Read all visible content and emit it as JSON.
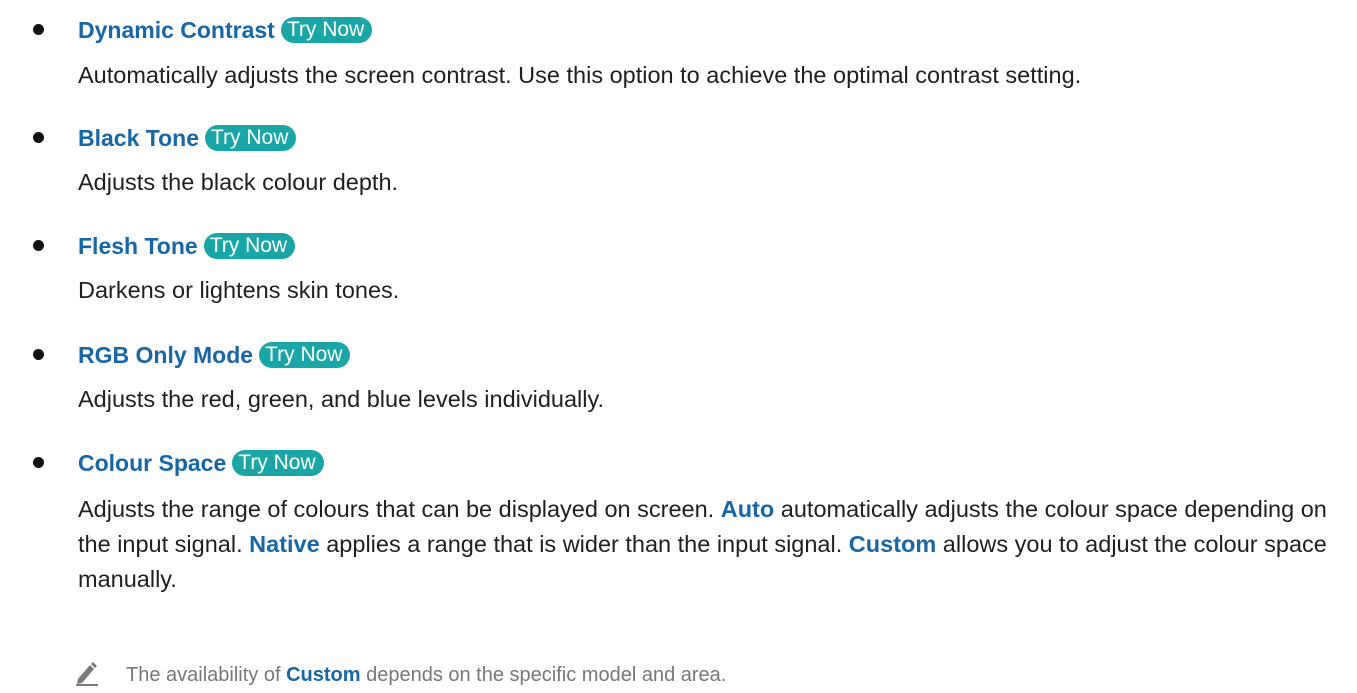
{
  "try_now_label": "Try Now",
  "items": [
    {
      "title": "Dynamic Contrast",
      "description": "Automatically adjusts the screen contrast. Use this option to achieve the optimal contrast setting."
    },
    {
      "title": "Black Tone",
      "description": "Adjusts the black colour depth."
    },
    {
      "title": "Flesh Tone",
      "description": "Darkens or lightens skin tones."
    },
    {
      "title": "RGB Only Mode",
      "description": "Adjusts the red, green, and blue levels individually."
    },
    {
      "title": "Colour Space",
      "description_parts": {
        "p1": "Adjusts the range of colours that can be displayed on screen. ",
        "auto": "Auto",
        "p2": " automatically adjusts the colour space depending on the input signal. ",
        "native": "Native",
        "p3": " applies a range that is wider than the input signal. ",
        "custom": "Custom",
        "p4": " allows you to adjust the colour space manually."
      }
    }
  ],
  "note": {
    "icon": "pencil-icon",
    "p1": "The availability of ",
    "custom": "Custom",
    "p2": " depends on the specific model and area."
  },
  "colors": {
    "heading": "#1766a6",
    "try_now_bg": "#1aa6a6",
    "body_text": "#1f1f1f",
    "note_text": "#777777"
  }
}
